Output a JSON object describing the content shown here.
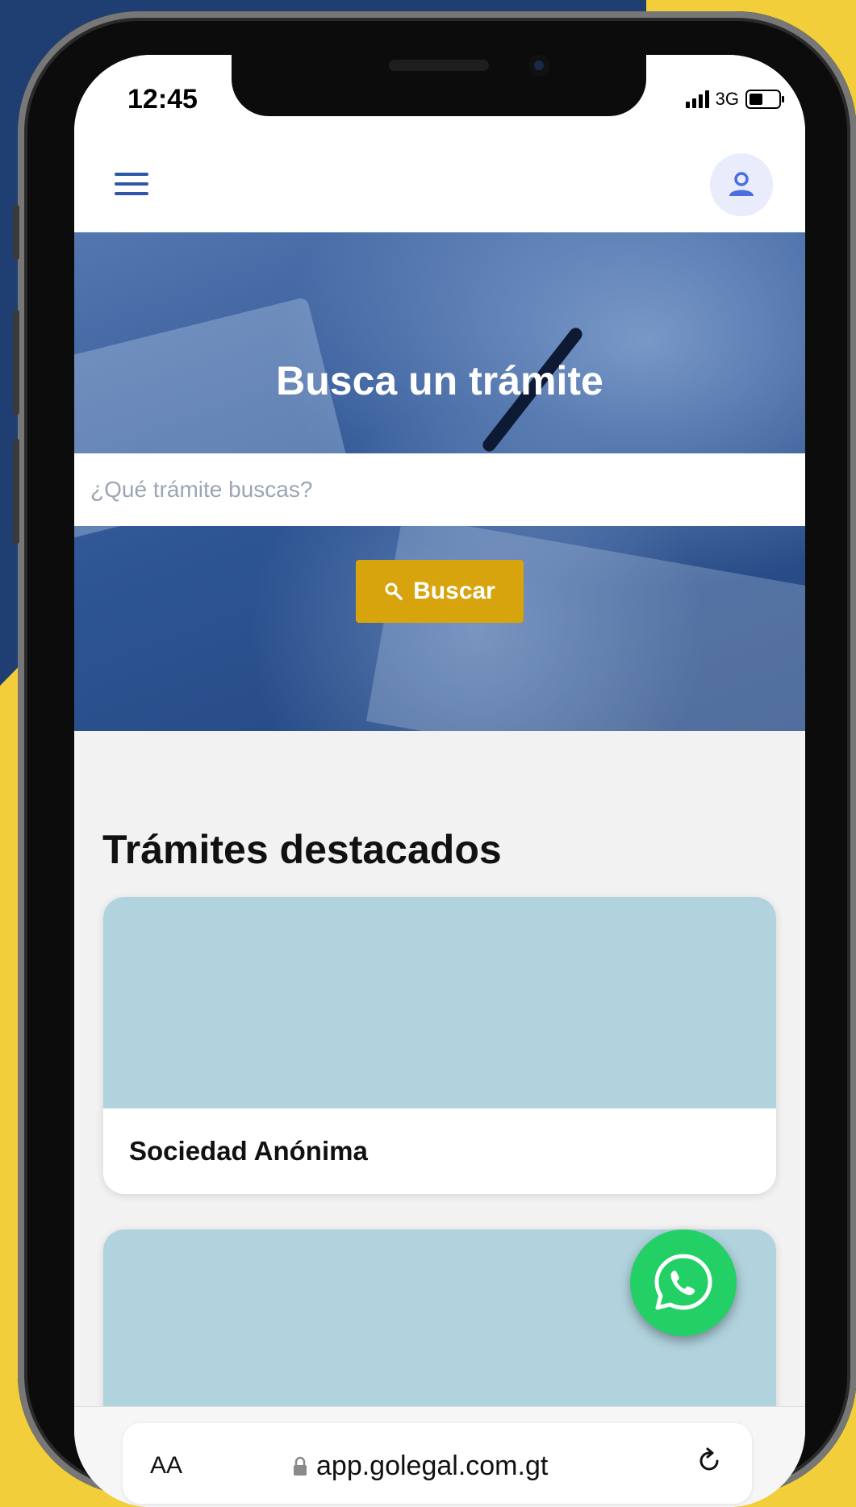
{
  "status_bar": {
    "time": "12:45",
    "network": "3G",
    "battery_level": 0.5
  },
  "hero": {
    "title": "Busca un trámite",
    "search_placeholder": "¿Qué trámite buscas?",
    "search_button": "Buscar"
  },
  "featured": {
    "title": "Trámites destacados",
    "cards": [
      {
        "label": "Sociedad Anónima"
      },
      {
        "label": ""
      }
    ]
  },
  "browser": {
    "text_size": "AA",
    "url": "app.golegal.com.gt"
  },
  "colors": {
    "navy_background": "#1f3f72",
    "yellow_background": "#f2cf3a",
    "button_gold": "#d7a40e",
    "card_image": "#b1d3de",
    "whatsapp_green": "#23d065",
    "accent_blue": "#2f56a8"
  },
  "icons": {
    "menu": "hamburger-icon",
    "profile": "user-icon",
    "search": "search-icon",
    "whatsapp": "whatsapp-icon",
    "lock": "lock-icon",
    "reload": "reload-icon"
  }
}
